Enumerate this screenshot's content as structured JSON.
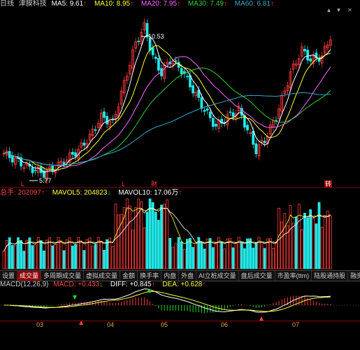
{
  "colors": {
    "up": "#ff3b3b",
    "down": "#22e6e6",
    "ma5": "#ffffff",
    "ma10": "#ffff33",
    "ma20": "#ff66ff",
    "ma30": "#33cc33",
    "ma60": "#33aacc"
  },
  "price_header": {
    "period": "日线",
    "stock_name": "津膜科技",
    "ma5_label": "MA5:",
    "ma5_value": "9.61",
    "ma10_label": "MA10:",
    "ma10_value": "8.95",
    "ma20_label": "MA20:",
    "ma20_value": "7.95",
    "ma30_label": "MA30:",
    "ma30_value": "7.49",
    "ma60_label": "MA60:",
    "ma60_value": "6.81"
  },
  "price_chart": {
    "high_label": "10.53",
    "low_label": "5.77",
    "marker_l1": "L",
    "marker_l2": "L",
    "marker_cai": "财",
    "marker_zhuan": "转"
  },
  "volume_header": {
    "total_label": "总手:",
    "total_value": "202097",
    "mavol5_label": "MAVOL5:",
    "mavol5_value": "204823",
    "mavol10_label": "MAVOL10:",
    "mavol10_value": "17.06万"
  },
  "tabs": [
    "设置",
    "成交量",
    "多周期成交量",
    "虚拟成交量",
    "金额",
    "换手率",
    "内盘",
    "外盘",
    "AI立桩成交量",
    "盘后成交量",
    "市盈率(ttm)",
    "陆股通持股",
    "融资"
  ],
  "macd_header": {
    "title": "MACD(12,26,9)",
    "macd_label": "MACD:",
    "macd_value": "+0.433",
    "diff_label": "DIFF:",
    "diff_value": "+0.845",
    "dea_label": "DEA:",
    "dea_value": "+0.628"
  },
  "x_axis": [
    "03",
    "04",
    "05",
    "06",
    "07"
  ],
  "top_icons": [
    "chevron-up-icon",
    "chevron-down-icon",
    "close-icon"
  ]
}
